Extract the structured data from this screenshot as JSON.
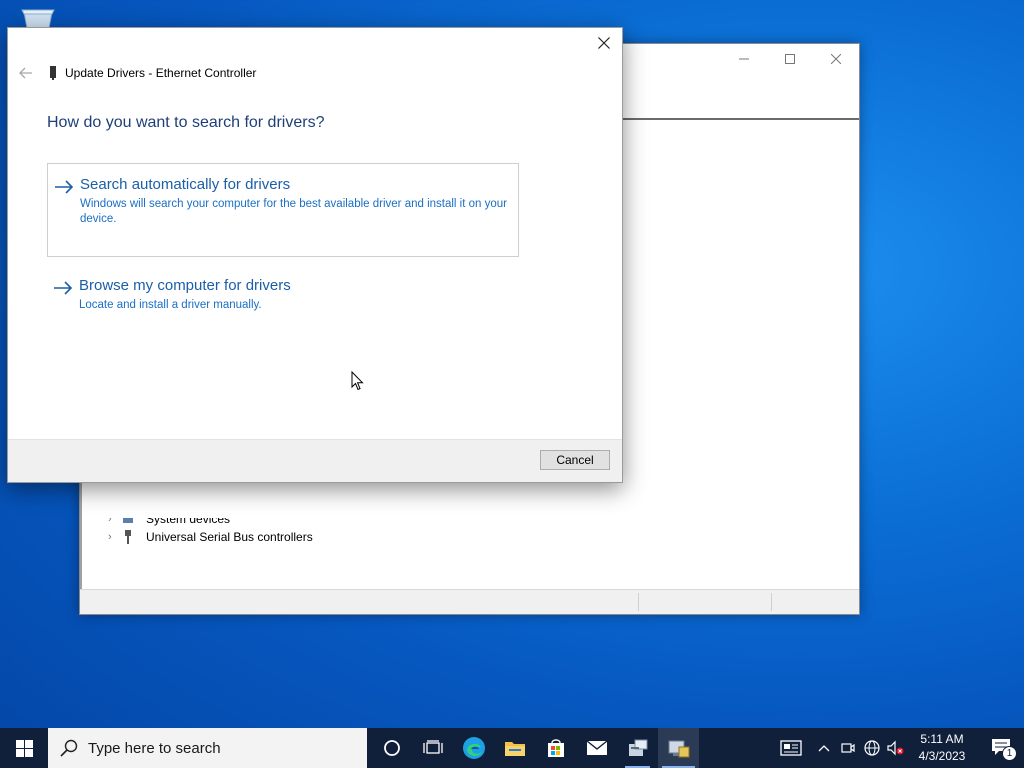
{
  "dialog": {
    "title": "Update Drivers - Ethernet Controller",
    "heading": "How do you want to search for drivers?",
    "options": [
      {
        "title": "Search automatically for drivers",
        "description": "Windows will search your computer for the best available driver and install it on your device."
      },
      {
        "title": "Browse my computer for drivers",
        "description": "Locate and install a driver manually."
      }
    ],
    "cancel_label": "Cancel"
  },
  "device_manager": {
    "visible_nodes": [
      {
        "label": "System devices"
      },
      {
        "label": "Universal Serial Bus controllers"
      }
    ]
  },
  "taskbar": {
    "search_placeholder": "Type here to search",
    "apps": [
      "cortana-icon",
      "task-view-icon",
      "edge-icon",
      "file-explorer-icon",
      "store-icon",
      "mail-icon",
      "network-app-icon",
      "device-manager-icon"
    ],
    "clock": {
      "time": "5:11 AM",
      "date": "4/3/2023"
    },
    "notification_count": "1"
  },
  "colors": {
    "desktop_blue": "#0b6fd6",
    "link_blue": "#1a5fa8",
    "heading_blue": "#1e3f78",
    "taskbar": "#101f3a"
  }
}
